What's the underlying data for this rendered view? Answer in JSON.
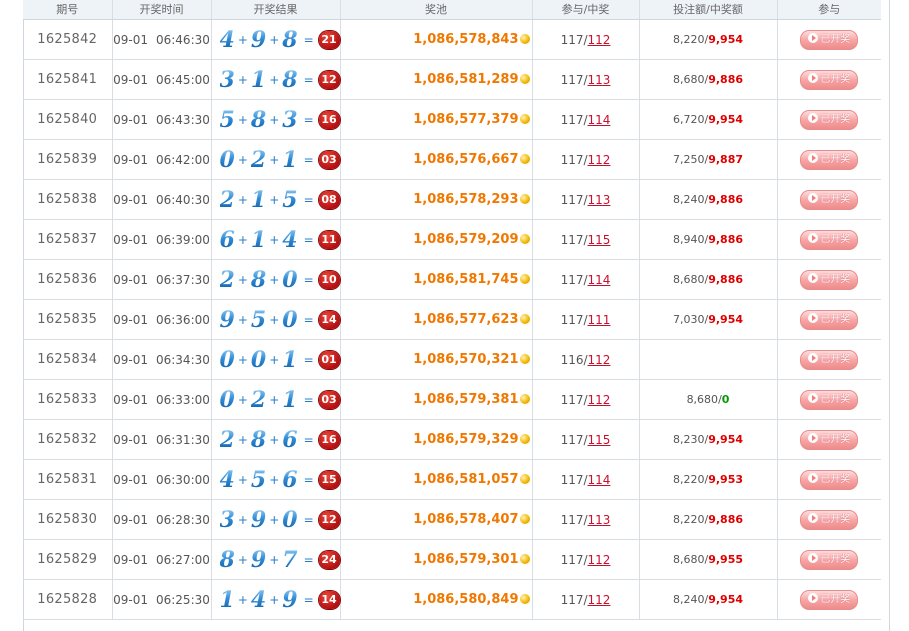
{
  "headers": {
    "issue": "期号",
    "time": "开奖时间",
    "result": "开奖结果",
    "pool": "奖池",
    "participation": "参与/中奖",
    "bet": "投注额/中奖额",
    "join": "参与"
  },
  "join_button_label": "已开奖",
  "rows": [
    {
      "issue": "1625842",
      "date": "09-01",
      "time": "06:46:30",
      "d1": "4",
      "d2": "9",
      "d3": "8",
      "sum": "21",
      "pool": "1,086,578,843",
      "part": "117",
      "win": "112",
      "bet": "8,220",
      "win_amt": "9,954"
    },
    {
      "issue": "1625841",
      "date": "09-01",
      "time": "06:45:00",
      "d1": "3",
      "d2": "1",
      "d3": "8",
      "sum": "12",
      "pool": "1,086,581,289",
      "part": "117",
      "win": "113",
      "bet": "8,680",
      "win_amt": "9,886"
    },
    {
      "issue": "1625840",
      "date": "09-01",
      "time": "06:43:30",
      "d1": "5",
      "d2": "8",
      "d3": "3",
      "sum": "16",
      "pool": "1,086,577,379",
      "part": "117",
      "win": "114",
      "bet": "6,720",
      "win_amt": "9,954"
    },
    {
      "issue": "1625839",
      "date": "09-01",
      "time": "06:42:00",
      "d1": "0",
      "d2": "2",
      "d3": "1",
      "sum": "03",
      "pool": "1,086,576,667",
      "part": "117",
      "win": "112",
      "bet": "7,250",
      "win_amt": "9,887"
    },
    {
      "issue": "1625838",
      "date": "09-01",
      "time": "06:40:30",
      "d1": "2",
      "d2": "1",
      "d3": "5",
      "sum": "08",
      "pool": "1,086,578,293",
      "part": "117",
      "win": "113",
      "bet": "8,240",
      "win_amt": "9,886"
    },
    {
      "issue": "1625837",
      "date": "09-01",
      "time": "06:39:00",
      "d1": "6",
      "d2": "1",
      "d3": "4",
      "sum": "11",
      "pool": "1,086,579,209",
      "part": "117",
      "win": "115",
      "bet": "8,940",
      "win_amt": "9,886"
    },
    {
      "issue": "1625836",
      "date": "09-01",
      "time": "06:37:30",
      "d1": "2",
      "d2": "8",
      "d3": "0",
      "sum": "10",
      "pool": "1,086,581,745",
      "part": "117",
      "win": "114",
      "bet": "8,680",
      "win_amt": "9,886"
    },
    {
      "issue": "1625835",
      "date": "09-01",
      "time": "06:36:00",
      "d1": "9",
      "d2": "5",
      "d3": "0",
      "sum": "14",
      "pool": "1,086,577,623",
      "part": "117",
      "win": "111",
      "bet": "7,030",
      "win_amt": "9,954"
    },
    {
      "issue": "1625834",
      "date": "09-01",
      "time": "06:34:30",
      "d1": "0",
      "d2": "0",
      "d3": "1",
      "sum": "01",
      "pool": "1,086,570,321",
      "part": "116",
      "win": "112",
      "bet": "",
      "win_amt": ""
    },
    {
      "issue": "1625833",
      "date": "09-01",
      "time": "06:33:00",
      "d1": "0",
      "d2": "2",
      "d3": "1",
      "sum": "03",
      "pool": "1,086,579,381",
      "part": "117",
      "win": "112",
      "bet": "8,680",
      "win_amt": "0"
    },
    {
      "issue": "1625832",
      "date": "09-01",
      "time": "06:31:30",
      "d1": "2",
      "d2": "8",
      "d3": "6",
      "sum": "16",
      "pool": "1,086,579,329",
      "part": "117",
      "win": "115",
      "bet": "8,230",
      "win_amt": "9,954"
    },
    {
      "issue": "1625831",
      "date": "09-01",
      "time": "06:30:00",
      "d1": "4",
      "d2": "5",
      "d3": "6",
      "sum": "15",
      "pool": "1,086,581,057",
      "part": "117",
      "win": "114",
      "bet": "8,220",
      "win_amt": "9,953"
    },
    {
      "issue": "1625830",
      "date": "09-01",
      "time": "06:28:30",
      "d1": "3",
      "d2": "9",
      "d3": "0",
      "sum": "12",
      "pool": "1,086,578,407",
      "part": "117",
      "win": "113",
      "bet": "8,220",
      "win_amt": "9,886"
    },
    {
      "issue": "1625829",
      "date": "09-01",
      "time": "06:27:00",
      "d1": "8",
      "d2": "9",
      "d3": "7",
      "sum": "24",
      "pool": "1,086,579,301",
      "part": "117",
      "win": "112",
      "bet": "8,680",
      "win_amt": "9,955"
    },
    {
      "issue": "1625828",
      "date": "09-01",
      "time": "06:25:30",
      "d1": "1",
      "d2": "4",
      "d3": "9",
      "sum": "14",
      "pool": "1,086,580,849",
      "part": "117",
      "win": "112",
      "bet": "8,240",
      "win_amt": "9,954"
    }
  ],
  "colors": {
    "pool": "#f07800",
    "win_amount": "#e00000",
    "win_zero": "#009900",
    "win_link": "#c8102e",
    "digit": "#2f8bd6",
    "sum_ball": "#b50e10",
    "button": "#f7a6a6"
  }
}
